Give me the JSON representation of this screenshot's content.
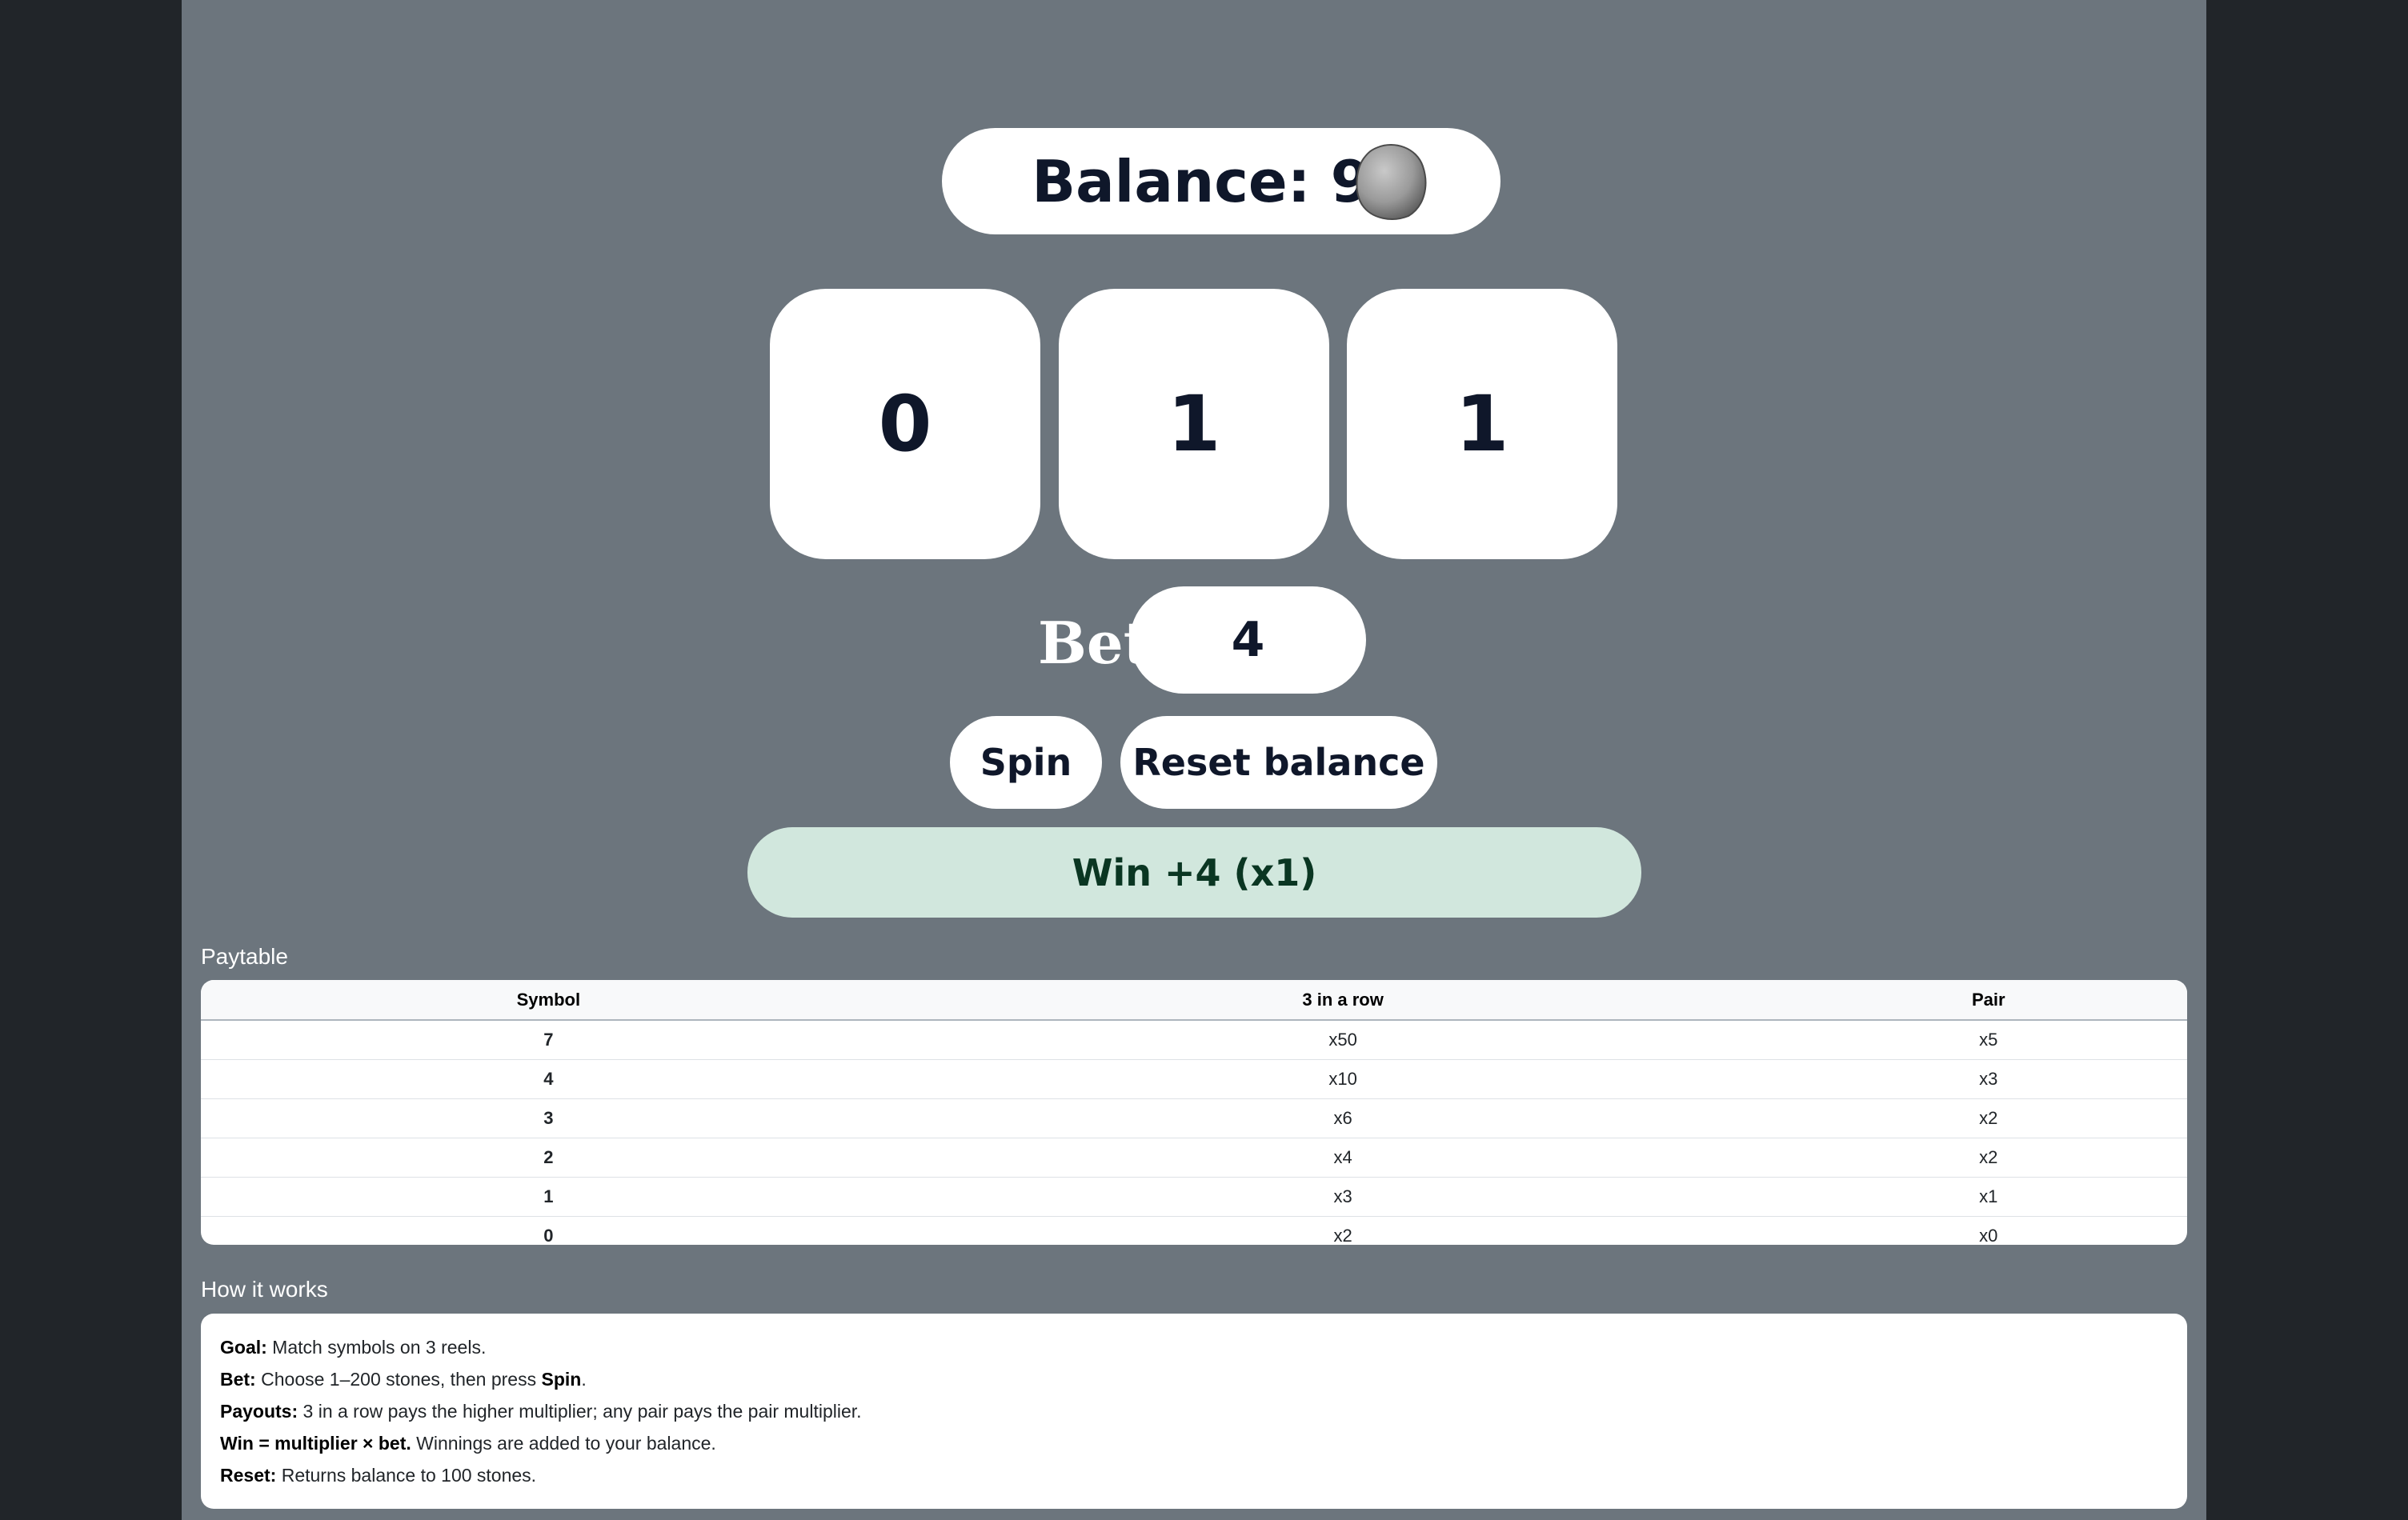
{
  "balance": {
    "text": "Balance: 95"
  },
  "reels": [
    "0",
    "1",
    "1"
  ],
  "bet": {
    "label": "Bet",
    "value": "4"
  },
  "buttons": {
    "spin": "Spin",
    "reset": "Reset balance"
  },
  "result": {
    "text": "Win +4 (x1)",
    "color": "#d1e7dd"
  },
  "paytable": {
    "title": "Paytable",
    "headers": [
      "Symbol",
      "3 in a row",
      "Pair"
    ],
    "rows": [
      [
        "7",
        "x50",
        "x5"
      ],
      [
        "4",
        "x10",
        "x3"
      ],
      [
        "3",
        "x6",
        "x2"
      ],
      [
        "2",
        "x4",
        "x2"
      ],
      [
        "1",
        "x3",
        "x1"
      ],
      [
        "0",
        "x2",
        "x0"
      ]
    ]
  },
  "how": {
    "title": "How it works",
    "lines": [
      {
        "label": "Goal:",
        "text": " Match symbols on 3 reels."
      },
      {
        "label": "Bet:",
        "text": " Choose 1–200 stones, then press ",
        "strong": "Spin",
        "after": "."
      },
      {
        "label": "Payouts:",
        "text": " 3 in a row pays the higher multiplier; any pair pays the pair multiplier."
      },
      {
        "label": "Win = multiplier × bet.",
        "text": " Winnings are added to your balance."
      },
      {
        "label": "Reset:",
        "text": " Returns balance to 100 stones."
      }
    ]
  },
  "icons": {
    "stone": "stone-icon"
  },
  "colors": {
    "page_bg": "#212529",
    "panel_bg": "#6c757d",
    "win_bg": "#d1e7dd",
    "win_text": "#0a3622"
  }
}
